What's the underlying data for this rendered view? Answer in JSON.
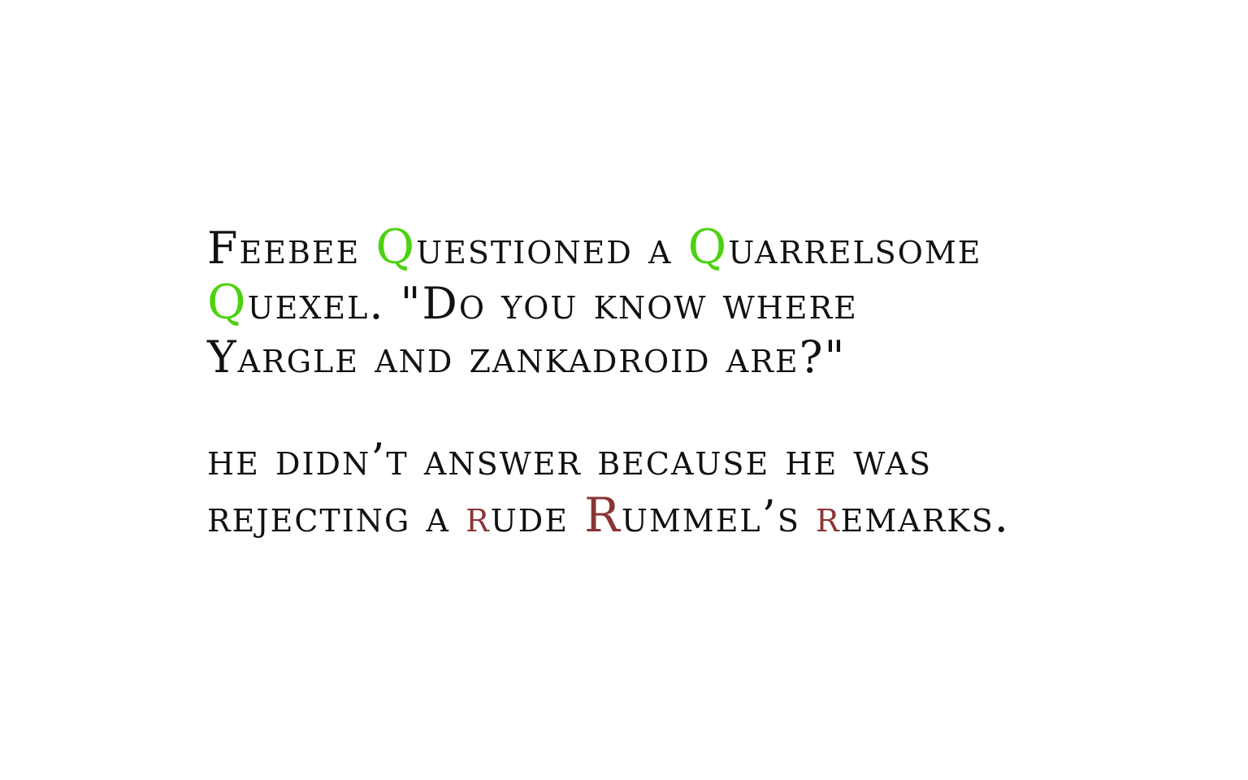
{
  "paragraph1": {
    "line1": {
      "a": "Feebee ",
      "q1": "Q",
      "b": "uestioned a ",
      "q2": "Q",
      "c": "uarrelsome"
    },
    "line2": {
      "q3": "Q",
      "a": "uexel. \"Do you know where"
    },
    "line3": {
      "a": "Yargle and zankadroid are?\""
    }
  },
  "paragraph2": {
    "line1": {
      "a": "he didn’t answer because he was"
    },
    "line2": {
      "a": "rejecting a ",
      "r1": "r",
      "b": "ude ",
      "r2": "R",
      "c": "ummel’s ",
      "r3": "r",
      "d": "emarks."
    }
  },
  "colors": {
    "q_highlight": "#4cd20f",
    "r_highlight": "#8b3434",
    "text": "#111111"
  }
}
